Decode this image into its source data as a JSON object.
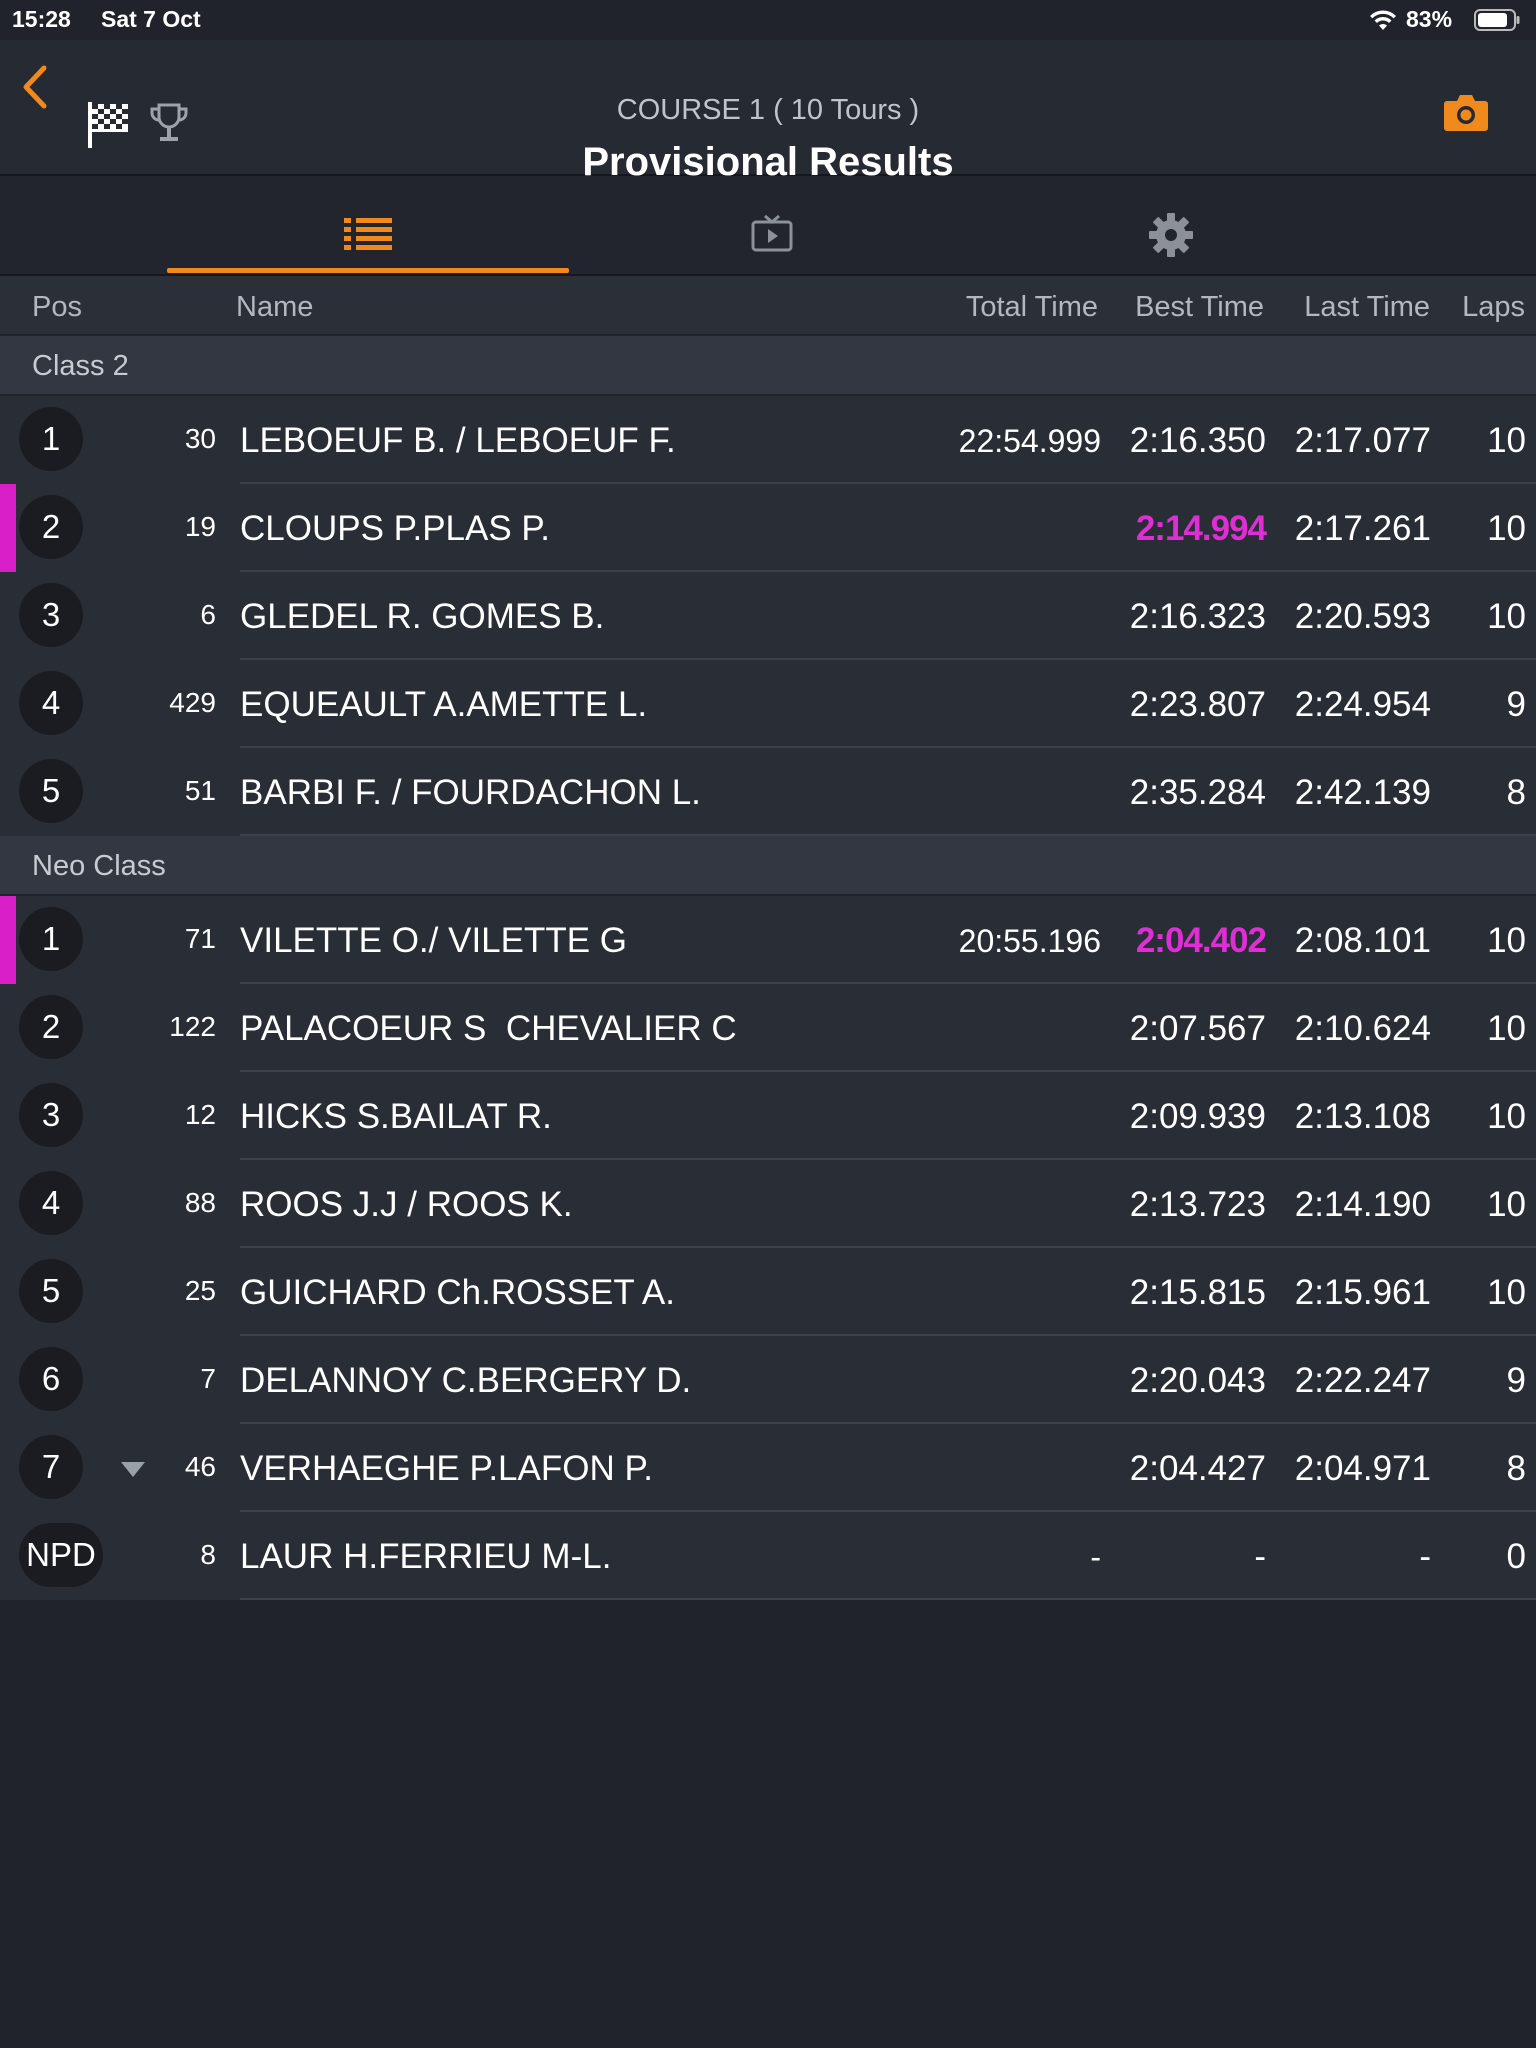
{
  "status_bar": {
    "time": "15:28",
    "date": "Sat 7 Oct",
    "battery": "83%"
  },
  "header": {
    "subtitle": "COURSE 1 ( 10 Tours )",
    "title": "Provisional Results",
    "icons": [
      "back-chevron-icon",
      "checkered-flag-icon",
      "trophy-icon",
      "camera-icon"
    ]
  },
  "tabs": [
    {
      "icon": "list-icon",
      "active": true
    },
    {
      "icon": "tv-play-icon",
      "active": false
    },
    {
      "icon": "gear-icon",
      "active": false
    }
  ],
  "columns": {
    "pos": "Pos",
    "name": "Name",
    "total": "Total Time",
    "best": "Best Time",
    "last": "Last Time",
    "laps": "Laps"
  },
  "accent_color": "#f08a1d",
  "highlight_color": "#de2fd4",
  "sections": [
    {
      "label": "Class 2",
      "rows": [
        {
          "pos": "1",
          "num": "30",
          "name": "LEBOEUF B. / LEBOEUF F.",
          "total": "22:54.999",
          "best": "2:16.350",
          "last": "2:17.077",
          "laps": "10"
        },
        {
          "pos": "2",
          "num": "19",
          "name": "CLOUPS P.PLAS P.",
          "total": "",
          "best": "2:14.994",
          "last": "2:17.261",
          "laps": "10",
          "best_highlight": true
        },
        {
          "pos": "3",
          "num": "6",
          "name": "GLEDEL R. GOMES B.",
          "total": "",
          "best": "2:16.323",
          "last": "2:20.593",
          "laps": "10"
        },
        {
          "pos": "4",
          "num": "429",
          "name": "EQUEAULT A.AMETTE L.",
          "total": "",
          "best": "2:23.807",
          "last": "2:24.954",
          "laps": "9"
        },
        {
          "pos": "5",
          "num": "51",
          "name": "BARBI F. / FOURDACHON L.",
          "total": "",
          "best": "2:35.284",
          "last": "2:42.139",
          "laps": "8"
        }
      ]
    },
    {
      "label": "Neo Class",
      "rows": [
        {
          "pos": "1",
          "num": "71",
          "name": "VILETTE O./ VILETTE G",
          "total": "20:55.196",
          "best": "2:04.402",
          "last": "2:08.101",
          "laps": "10",
          "best_highlight": true
        },
        {
          "pos": "2",
          "num": "122",
          "name": "PALACOEUR S  CHEVALIER C",
          "total": "",
          "best": "2:07.567",
          "last": "2:10.624",
          "laps": "10"
        },
        {
          "pos": "3",
          "num": "12",
          "name": "HICKS S.BAILAT R.",
          "total": "",
          "best": "2:09.939",
          "last": "2:13.108",
          "laps": "10"
        },
        {
          "pos": "4",
          "num": "88",
          "name": "ROOS J.J / ROOS K.",
          "total": "",
          "best": "2:13.723",
          "last": "2:14.190",
          "laps": "10"
        },
        {
          "pos": "5",
          "num": "25",
          "name": "GUICHARD Ch.ROSSET A.",
          "total": "",
          "best": "2:15.815",
          "last": "2:15.961",
          "laps": "10"
        },
        {
          "pos": "6",
          "num": "7",
          "name": "DELANNOY C.BERGERY D.",
          "total": "",
          "best": "2:20.043",
          "last": "2:22.247",
          "laps": "9"
        },
        {
          "pos": "7",
          "num": "46",
          "name": "VERHAEGHE P.LAFON P.",
          "total": "",
          "best": "2:04.427",
          "last": "2:04.971",
          "laps": "8",
          "position_change": "down"
        },
        {
          "pos": "NPD",
          "num": "8",
          "name": "LAUR H.FERRIEU M-L.",
          "total": "-",
          "best": "-",
          "last": "-",
          "laps": "0"
        }
      ]
    }
  ]
}
